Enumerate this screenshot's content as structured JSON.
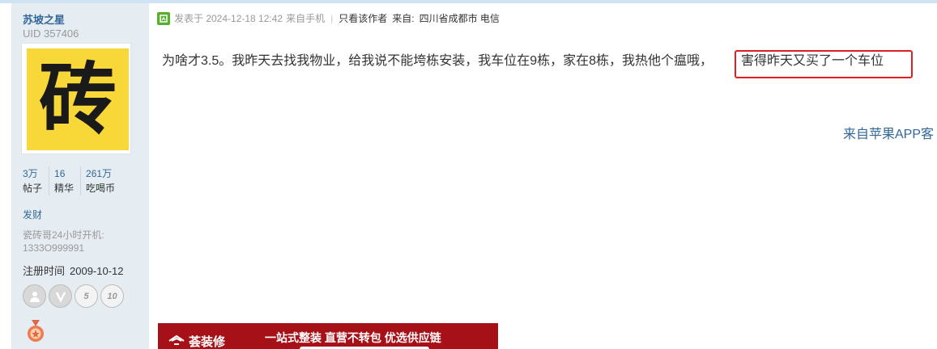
{
  "user": {
    "name": "苏坡之星",
    "uid": "UID 357406",
    "avatar_char": "砖",
    "stats": [
      {
        "value": "3万",
        "label": "帖子"
      },
      {
        "value": "16",
        "label": "精华"
      },
      {
        "value": "261万",
        "label": "吃喝币"
      }
    ],
    "action": "发财",
    "signature_line1": "瓷砖哥24小时开机:",
    "signature_line2": "1333O999991",
    "register_label": "注册时间",
    "register_date": "2009-10-12",
    "medals": [
      "user-medal",
      "v-medal",
      "5-years-medal",
      "10-years-medal"
    ],
    "medal_labels": {
      "five": "5",
      "ten": "10"
    }
  },
  "post": {
    "posted_label": "发表于 2024-12-18 12:42",
    "source": "来自手机",
    "author_only": "只看该作者",
    "from_label": "来自:",
    "location": "四川省成都市 电信",
    "content_main": "为啥才3.5。我昨天去找我物业，给我说不能垮栋安装，我车位在9栋，家在8栋，我热他个瘟哦，",
    "content_highlighted": "害得昨天又买了一个车位",
    "client": "来自苹果APP客"
  },
  "ad": {
    "brand": "荟装修",
    "slogan": "一站式整装  直营不转包  优选供应链"
  },
  "colors": {
    "sidebar_bg": "#e5edf2",
    "link_blue": "#336699",
    "highlight_red": "#e02020",
    "ad_red": "#a61017",
    "avatar_yellow": "#f8d838"
  }
}
